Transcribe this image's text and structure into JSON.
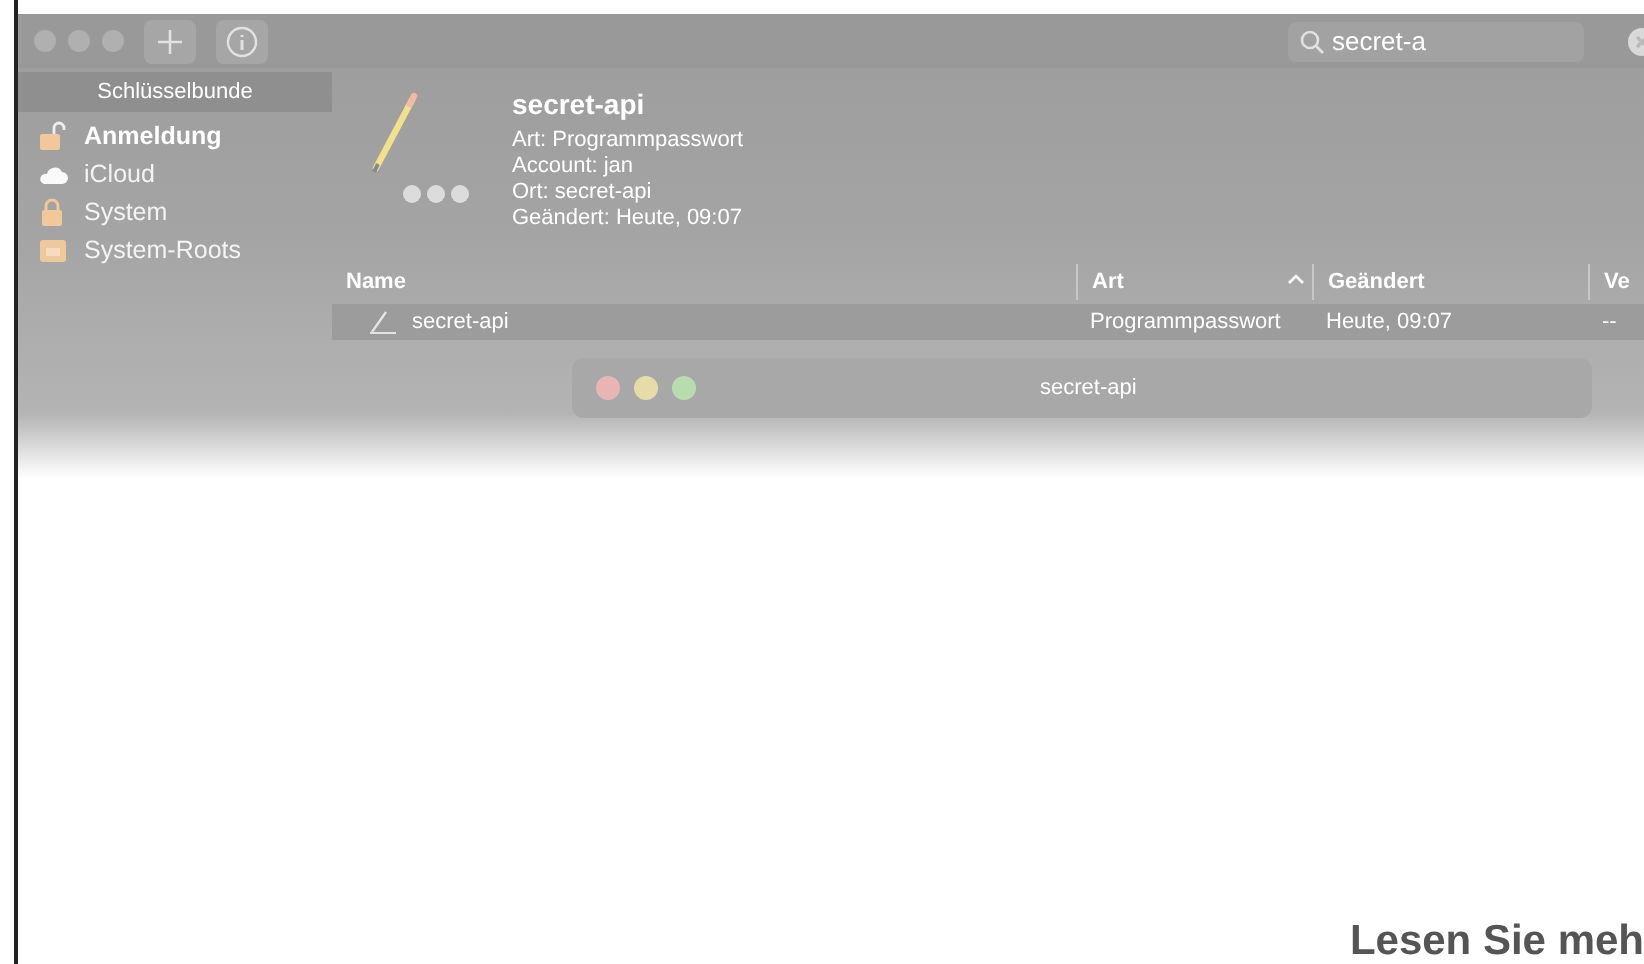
{
  "toolbar": {
    "search": {
      "value": "secret-a"
    }
  },
  "sidebar": {
    "title": "Schlüsselbunde",
    "items": [
      {
        "label": "Anmeldung",
        "selected": true,
        "kind": "unlocked"
      },
      {
        "label": "iCloud",
        "selected": false,
        "kind": "cloud"
      },
      {
        "label": "System",
        "selected": false,
        "kind": "locked"
      },
      {
        "label": "System-Roots",
        "selected": false,
        "kind": "folder"
      }
    ]
  },
  "detail": {
    "title": "secret-api",
    "lines": [
      "Art: Programmpasswort",
      "Account: jan",
      "Ort: secret-api",
      "Geändert: Heute, 09:07"
    ]
  },
  "table": {
    "columns": [
      {
        "label": "Name",
        "sorted": false
      },
      {
        "label": "Art",
        "sorted": true
      },
      {
        "label": "Geändert",
        "sorted": false
      },
      {
        "label": "Ve",
        "sorted": false
      }
    ],
    "rows": [
      {
        "cells": [
          "secret-api",
          "Programmpasswort",
          "Heute, 09:07",
          "--"
        ]
      }
    ]
  },
  "sheet": {
    "title": "secret-api"
  },
  "footer": {
    "heading": "Lesen Sie meh"
  }
}
